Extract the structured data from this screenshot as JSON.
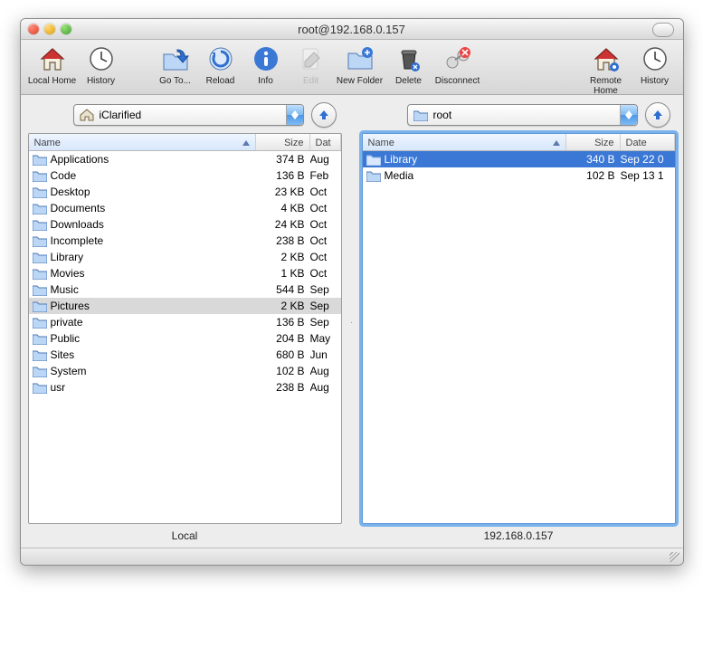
{
  "window": {
    "title": "root@192.168.0.157"
  },
  "toolbar": {
    "local_home": "Local Home",
    "history_l": "History",
    "goto": "Go To...",
    "reload": "Reload",
    "info": "Info",
    "edit": "Edit",
    "new_folder": "New Folder",
    "delete": "Delete",
    "disconnect": "Disconnect",
    "remote_home": "Remote Home",
    "history_r": "History"
  },
  "columns": {
    "name": "Name",
    "size": "Size",
    "date": "Date",
    "date_short": "Dat"
  },
  "local": {
    "path_label": "iClarified",
    "footer": "Local",
    "selected_index": 9,
    "rows": [
      {
        "name": "Applications",
        "size": "374 B",
        "date": "Aug"
      },
      {
        "name": "Code",
        "size": "136 B",
        "date": "Feb"
      },
      {
        "name": "Desktop",
        "size": "23 KB",
        "date": "Oct"
      },
      {
        "name": "Documents",
        "size": "4 KB",
        "date": "Oct"
      },
      {
        "name": "Downloads",
        "size": "24 KB",
        "date": "Oct"
      },
      {
        "name": "Incomplete",
        "size": "238 B",
        "date": "Oct"
      },
      {
        "name": "Library",
        "size": "2 KB",
        "date": "Oct"
      },
      {
        "name": "Movies",
        "size": "1 KB",
        "date": "Oct"
      },
      {
        "name": "Music",
        "size": "544 B",
        "date": "Sep"
      },
      {
        "name": "Pictures",
        "size": "2 KB",
        "date": "Sep"
      },
      {
        "name": "private",
        "size": "136 B",
        "date": "Sep"
      },
      {
        "name": "Public",
        "size": "204 B",
        "date": "May"
      },
      {
        "name": "Sites",
        "size": "680 B",
        "date": "Jun"
      },
      {
        "name": "System",
        "size": "102 B",
        "date": "Aug"
      },
      {
        "name": "usr",
        "size": "238 B",
        "date": "Aug"
      }
    ]
  },
  "remote": {
    "path_label": "root",
    "footer": "192.168.0.157",
    "selected_index": 0,
    "rows": [
      {
        "name": "Library",
        "size": "340 B",
        "date": "Sep 22 0"
      },
      {
        "name": "Media",
        "size": "102 B",
        "date": "Sep 13 1"
      }
    ]
  }
}
